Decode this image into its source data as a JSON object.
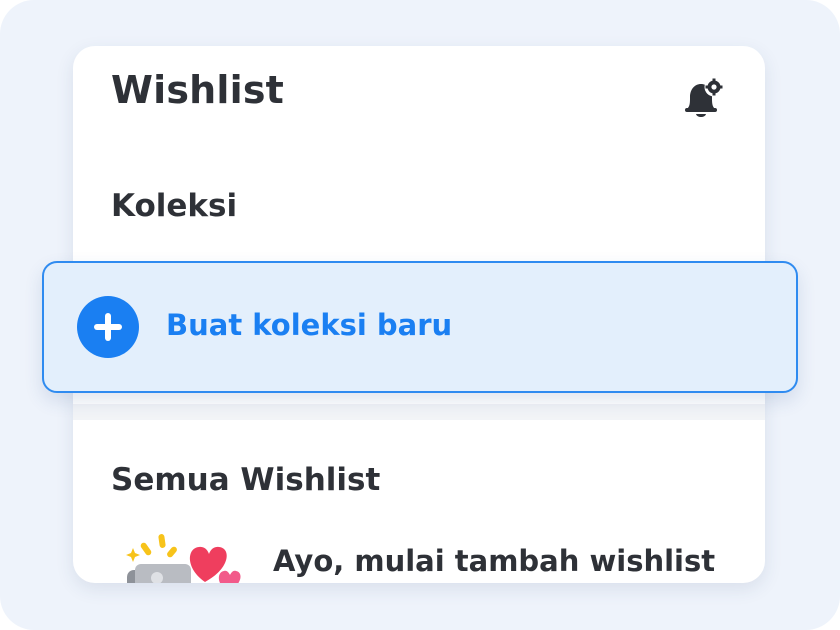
{
  "header": {
    "title": "Wishlist",
    "notification_icon": "bell-settings-icon"
  },
  "collections": {
    "heading": "Koleksi",
    "new_collection_label": "Buat koleksi baru",
    "new_collection_icon": "plus-circle-icon"
  },
  "all_wishlist": {
    "heading": "Semua Wishlist",
    "empty_message": "Ayo, mulai tambah wishlist",
    "illustration_icon": "wishlist-hearts-illustration-icon"
  },
  "colors": {
    "accent": "#1a7ff2",
    "highlight_bg": "#e3effc",
    "highlight_border": "#2f8bf0",
    "text_primary": "#2e3137",
    "page_bg": "#eef3fb"
  }
}
